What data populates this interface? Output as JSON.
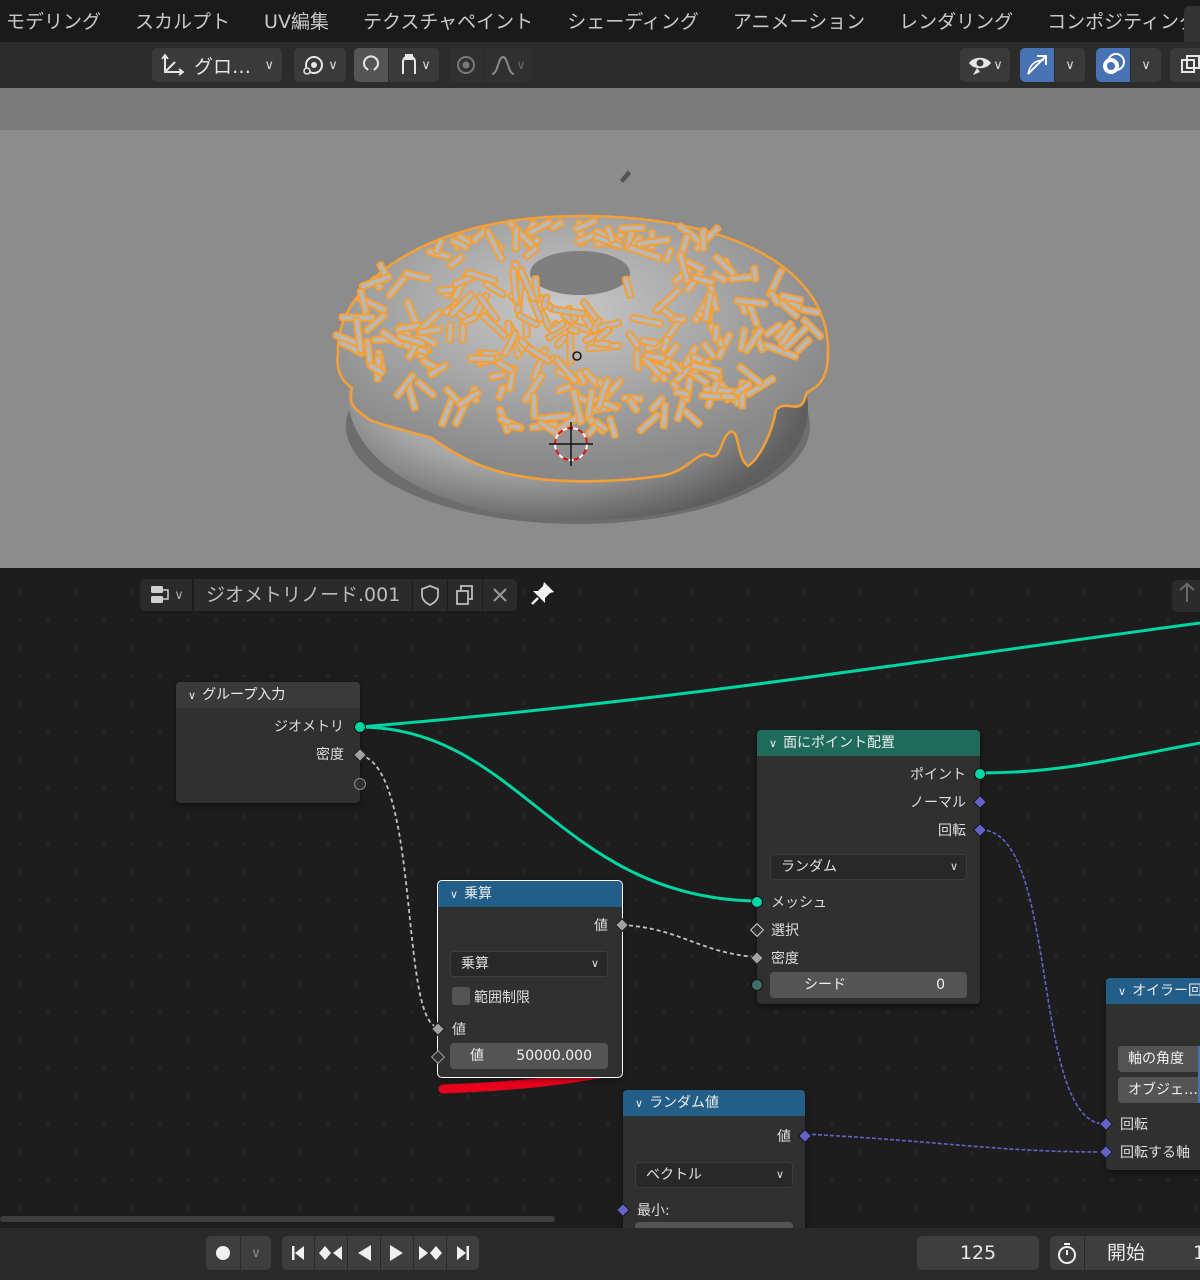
{
  "workspace_tabs": [
    "モデリング",
    "スカルプト",
    "UV編集",
    "テクスチャペイント",
    "シェーディング",
    "アニメーション",
    "レンダリング",
    "コンポジティング"
  ],
  "viewport_header": {
    "transform_orientation": "グロ…"
  },
  "node_editor": {
    "tree_name": "ジオメトリノード.001",
    "nodes": {
      "group_input": {
        "title": "グループ入力",
        "outputs": [
          "ジオメトリ",
          "密度"
        ]
      },
      "multiply": {
        "title": "乗算",
        "output": "値",
        "operation": "乗算",
        "clamp_label": "範囲制限",
        "input_label": "値",
        "field_label": "値",
        "field_value": "50000.000"
      },
      "distribute_points": {
        "title": "面にポイント配置",
        "outputs": [
          "ポイント",
          "ノーマル",
          "回転"
        ],
        "mode": "ランダム",
        "inputs": [
          "メッシュ",
          "選択",
          "密度"
        ],
        "seed_label": "シード",
        "seed_value": "0"
      },
      "random_value": {
        "title": "ランダム値",
        "output": "値",
        "data_type": "ベクトル",
        "min_label": "最小:"
      },
      "euler": {
        "title": "オイラー回",
        "axis_angle_label": "軸の角度",
        "object_label": "オブジェ…",
        "inputs": [
          "回転",
          "回転する軸"
        ]
      }
    }
  },
  "timeline": {
    "current_frame": "125",
    "start_label": "開始",
    "start_value_partial": "1"
  },
  "colors": {
    "geometry_socket": "#00d6a3",
    "vector_socket": "#6363c7",
    "float_socket": "#a1a1a1",
    "selection_outline": "#f5a036",
    "annotation_stroke": "#e8001c",
    "active_button": "#4772b3"
  }
}
